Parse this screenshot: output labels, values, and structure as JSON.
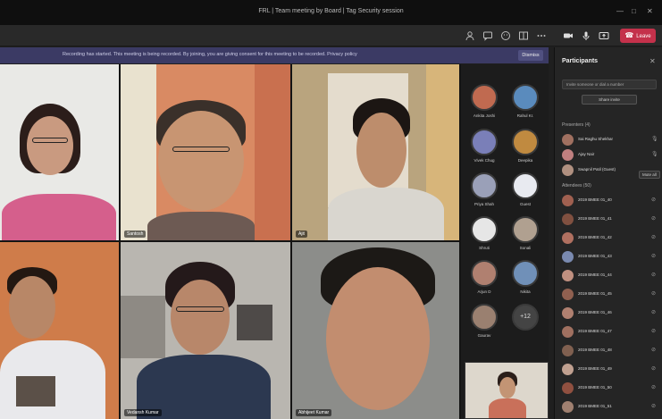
{
  "window": {
    "title": "FRL | Team meeting by Board | Tag Security session",
    "controls": [
      "—",
      "□",
      "✕"
    ]
  },
  "toolbar": {
    "icons": [
      "people-icon",
      "chat-icon",
      "reactions-icon",
      "rooms-icon",
      "more-icon",
      "camera-icon",
      "mic-icon",
      "share-icon"
    ],
    "leave_label": "Leave"
  },
  "banner": {
    "text": "Recording has started. This meeting is being recorded. By joining, you are giving consent for this meeting to be recorded. Privacy policy",
    "dismiss_label": "Dismiss"
  },
  "tiles": [
    {
      "name": ""
    },
    {
      "name": "Santosh"
    },
    {
      "name": "Ajit"
    },
    {
      "name": ""
    },
    {
      "name": "Vedansh Kumar"
    },
    {
      "name": "Abhijeet Kumar"
    }
  ],
  "avatar_grid": [
    {
      "label": "Ankita Joshi",
      "color": "#c06a50"
    },
    {
      "label": "Rahul Kr.",
      "color": "#5a8bbd"
    },
    {
      "label": "Vivek Chug",
      "color": "#7a7fb8"
    },
    {
      "label": "Deepika",
      "color": "#c08a40"
    },
    {
      "label": "Priya Shah",
      "color": "#9aa0b8"
    },
    {
      "label": "Guest",
      "color": "#e8eaf0"
    },
    {
      "label": "Shruti",
      "color": "#e6e6e6"
    },
    {
      "label": "Sonali",
      "color": "#b0a090"
    },
    {
      "label": "Arjun D",
      "color": "#b08070"
    },
    {
      "label": "Nikita",
      "color": "#7090b8"
    },
    {
      "label": "Gaurav",
      "color": "#9a8070"
    },
    {
      "label": "+12",
      "color": "#444444"
    }
  ],
  "panel": {
    "title": "Participants",
    "close": "✕",
    "invite_placeholder": "Invite someone or dial a number",
    "share_label": "Share invite",
    "presenters_label": "Presenters (4)",
    "mute_all_label": "Mute all",
    "attendees_label": "Attendees (50)",
    "presenters": [
      {
        "name": "Sai Raghu Shekhar",
        "color": "#a07060"
      },
      {
        "name": "Ajay Nair",
        "color": "#c08080"
      },
      {
        "name": "Swapnil Patil (Guest)",
        "color": "#b09080"
      }
    ],
    "attendees": [
      {
        "name": "2019 BMEE 01_40",
        "color": "#a06050"
      },
      {
        "name": "2019 BMEE 01_41",
        "color": "#805040"
      },
      {
        "name": "2019 BMEE 01_42",
        "color": "#b07060"
      },
      {
        "name": "2019 BMEE 01_43",
        "color": "#7a8ab0"
      },
      {
        "name": "2019 BMEE 01_44",
        "color": "#c09080"
      },
      {
        "name": "2019 BMEE 01_45",
        "color": "#906050"
      },
      {
        "name": "2019 BMEE 01_46",
        "color": "#b08070"
      },
      {
        "name": "2019 BMEE 01_47",
        "color": "#a07060"
      },
      {
        "name": "2019 BMEE 01_48",
        "color": "#806050"
      },
      {
        "name": "2019 BMEE 01_49",
        "color": "#c0a090"
      },
      {
        "name": "2019 BMEE 01_50",
        "color": "#905040"
      },
      {
        "name": "2019 BMEE 01_51",
        "color": "#a08070"
      }
    ]
  }
}
